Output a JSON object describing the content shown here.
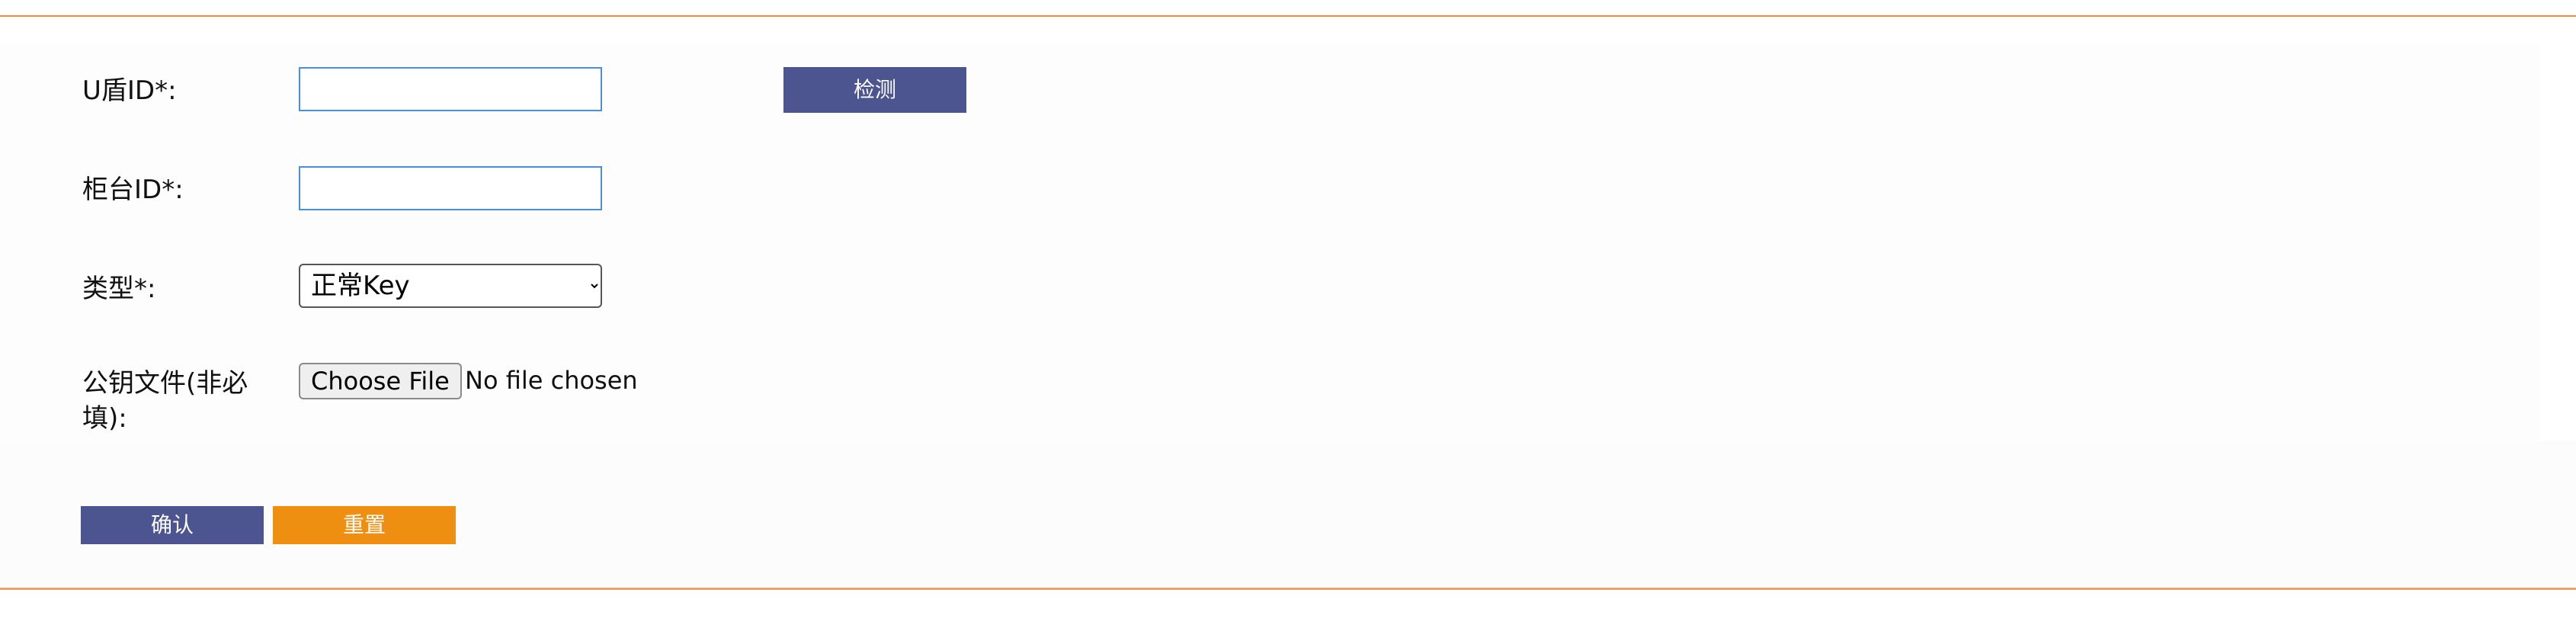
{
  "form": {
    "ukey_id": {
      "label": "U盾ID*:",
      "value": ""
    },
    "counter_id": {
      "label": "柜台ID*:",
      "value": ""
    },
    "type": {
      "label": "类型*:",
      "selected": "正常Key"
    },
    "public_key_file": {
      "label": "公钥文件(非必填):",
      "button_label": "Choose File",
      "status": "No file chosen"
    }
  },
  "actions": {
    "detect_label": "检测",
    "confirm_label": "确认",
    "reset_label": "重置"
  },
  "colors": {
    "accent_border": "#f08a3c",
    "primary_button": "#4c5590",
    "reset_button": "#ef8f12",
    "input_border": "#4a90d9"
  }
}
